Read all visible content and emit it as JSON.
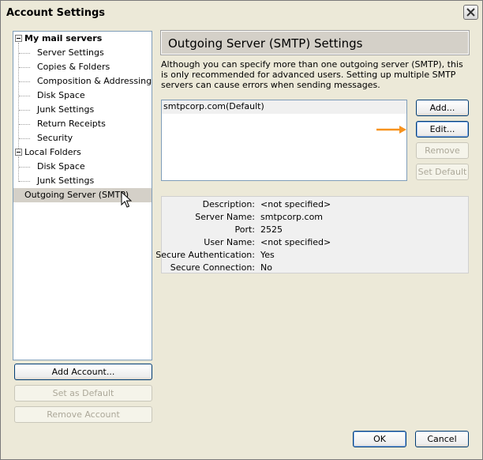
{
  "window": {
    "title": "Account Settings"
  },
  "tree": {
    "items": [
      {
        "label": "My mail servers",
        "bold": true
      },
      {
        "label": "Server Settings"
      },
      {
        "label": "Copies & Folders"
      },
      {
        "label": "Composition & Addressing"
      },
      {
        "label": "Disk Space"
      },
      {
        "label": "Junk Settings"
      },
      {
        "label": "Return Receipts"
      },
      {
        "label": "Security"
      },
      {
        "label": "Local Folders",
        "bold": false
      },
      {
        "label": "Disk Space"
      },
      {
        "label": "Junk Settings"
      },
      {
        "label": "Outgoing Server (SMTP)",
        "selected": true
      }
    ]
  },
  "left_buttons": {
    "add_account": "Add Account...",
    "set_default": "Set as Default",
    "remove_account": "Remove Account"
  },
  "panel": {
    "title": "Outgoing Server (SMTP) Settings",
    "description": "Although you can specify more than one outgoing server (SMTP), this is only recommended for advanced users. Setting up multiple SMTP servers can cause errors when sending messages.",
    "servers": [
      "smtpcorp.com(Default)"
    ],
    "buttons": {
      "add": "Add...",
      "edit": "Edit...",
      "remove": "Remove",
      "set_default": "Set Default"
    },
    "details": [
      {
        "label": "Description:",
        "value": "<not specified>"
      },
      {
        "label": "Server Name:",
        "value": "smtpcorp.com"
      },
      {
        "label": "Port:",
        "value": "2525"
      },
      {
        "label": "User Name:",
        "value": "<not specified>"
      },
      {
        "label": "Secure Authentication:",
        "value": "Yes"
      },
      {
        "label": "Secure Connection:",
        "value": "No"
      }
    ]
  },
  "footer": {
    "ok": "OK",
    "cancel": "Cancel"
  },
  "colors": {
    "accent_arrow": "#f7931e",
    "selection": "#d4d0c8"
  }
}
